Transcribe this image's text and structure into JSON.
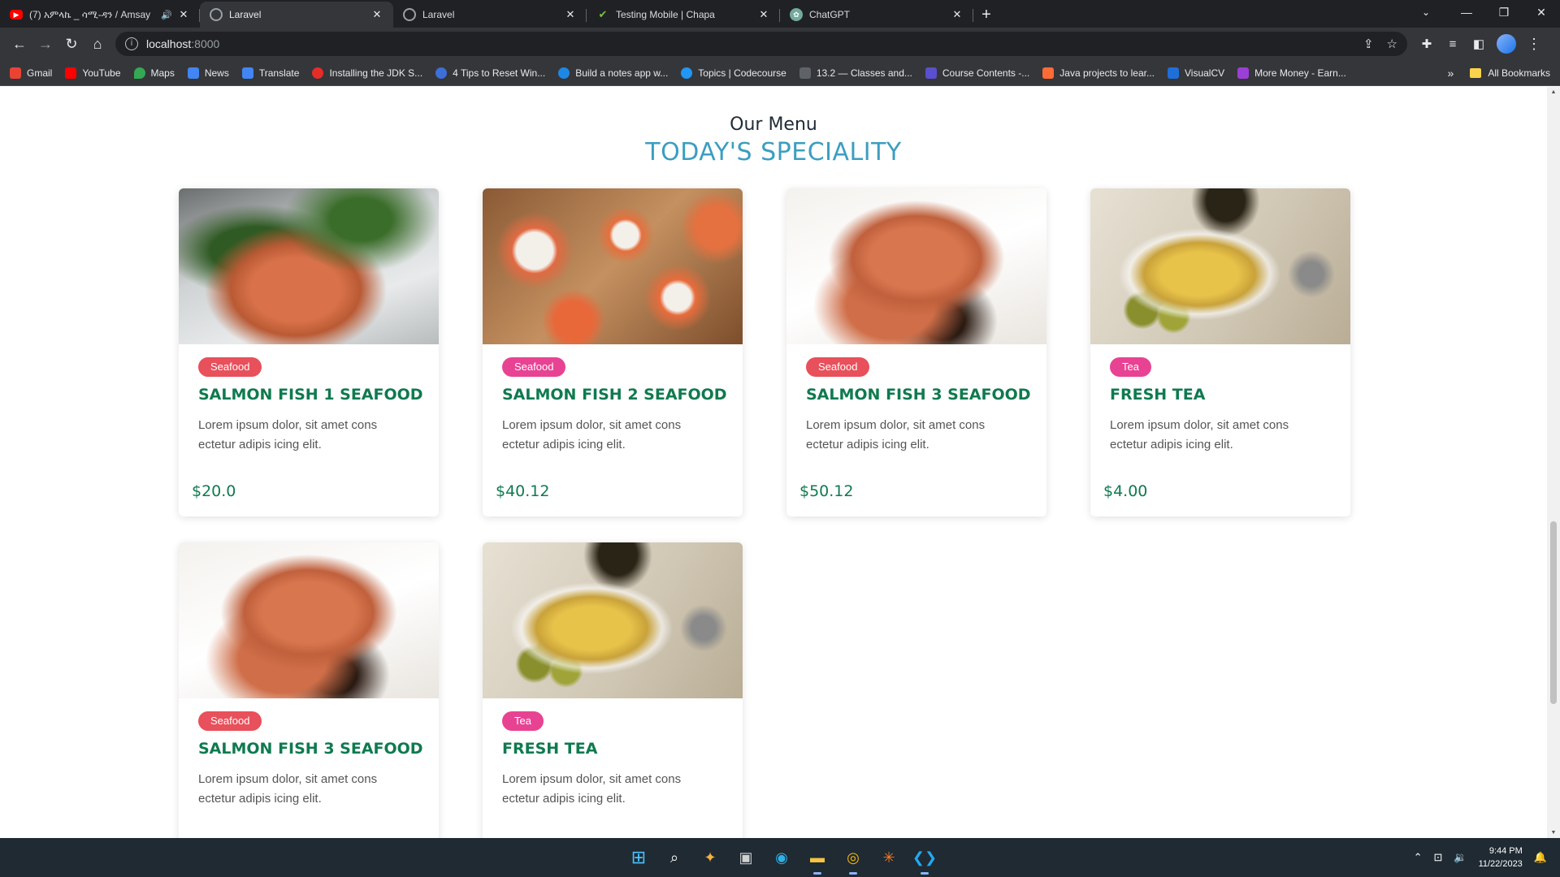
{
  "browser": {
    "tabs": [
      {
        "title": "(7) አምላኬ _ ሳሚ-ዳን / Amsay",
        "favicon_color": "#ff0000",
        "favicon_icon": "youtube-icon",
        "audio": true
      },
      {
        "title": "Laravel",
        "favicon_color": "#9aa0a6",
        "favicon_icon": "globe-icon",
        "active": true
      },
      {
        "title": "Laravel",
        "favicon_color": "#9aa0a6",
        "favicon_icon": "globe-icon"
      },
      {
        "title": "Testing Mobile | Chapa",
        "favicon_color": "#7ac142",
        "favicon_icon": "chapa-icon"
      },
      {
        "title": "ChatGPT",
        "favicon_color": "#74aa9c",
        "favicon_icon": "chatgpt-icon"
      }
    ],
    "url_host": "localhost",
    "url_rest": ":8000",
    "bookmarks": [
      {
        "label": "Gmail",
        "color": "#ea4335"
      },
      {
        "label": "YouTube",
        "color": "#ff0000"
      },
      {
        "label": "Maps",
        "color": "#34a853"
      },
      {
        "label": "News",
        "color": "#4285f4"
      },
      {
        "label": "Translate",
        "color": "#4285f4"
      },
      {
        "label": "Installing the JDK S...",
        "color": "#e52d27"
      },
      {
        "label": "4 Tips to Reset Win...",
        "color": "#3c6fd8"
      },
      {
        "label": "Build a notes app w...",
        "color": "#1e88e5"
      },
      {
        "label": "Topics | Codecourse",
        "color": "#2196f3"
      },
      {
        "label": "13.2 — Classes and...",
        "color": "#5f6368"
      },
      {
        "label": "Course Contents -...",
        "color": "#5a4fcf"
      },
      {
        "label": "Java projects to lear...",
        "color": "#ff6b35"
      },
      {
        "label": "VisualCV",
        "color": "#1e6fd9"
      },
      {
        "label": "More Money - Earn...",
        "color": "#9b3fd6"
      }
    ],
    "all_bookmarks_label": "All Bookmarks"
  },
  "page": {
    "subtitle": "Our Menu",
    "title": "TODAY'S SPECIALITY",
    "cards": [
      {
        "category": "Seafood",
        "title": "SALMON FISH 1 SEAFOOD",
        "desc": "Lorem ipsum dolor, sit amet cons ectetur adipis icing elit.",
        "price": "$20.0"
      },
      {
        "category": "Seafood",
        "title": "SALMON FISH 2 SEAFOOD",
        "desc": "Lorem ipsum dolor, sit amet cons ectetur adipis icing elit.",
        "price": "$40.12"
      },
      {
        "category": "Seafood",
        "title": "SALMON FISH 3 SEAFOOD",
        "desc": "Lorem ipsum dolor, sit amet cons ectetur adipis icing elit.",
        "price": "$50.12"
      },
      {
        "category": "Tea",
        "title": "FRESH TEA",
        "desc": "Lorem ipsum dolor, sit amet cons ectetur adipis icing elit.",
        "price": "$4.00"
      },
      {
        "category": "Seafood",
        "title": "SALMON FISH 3 SEAFOOD",
        "desc": "Lorem ipsum dolor, sit amet cons ectetur adipis icing elit.",
        "price": ""
      },
      {
        "category": "Tea",
        "title": "FRESH TEA",
        "desc": "Lorem ipsum dolor, sit amet cons ectetur adipis icing elit.",
        "price": ""
      }
    ]
  },
  "taskbar": {
    "time": "9:44 PM",
    "date": "11/22/2023"
  },
  "colors": {
    "accent_title": "#3b9ec0",
    "card_title": "#0f7a4f",
    "badge_seafood": "#e8505b",
    "badge_tea": "#e84393"
  }
}
